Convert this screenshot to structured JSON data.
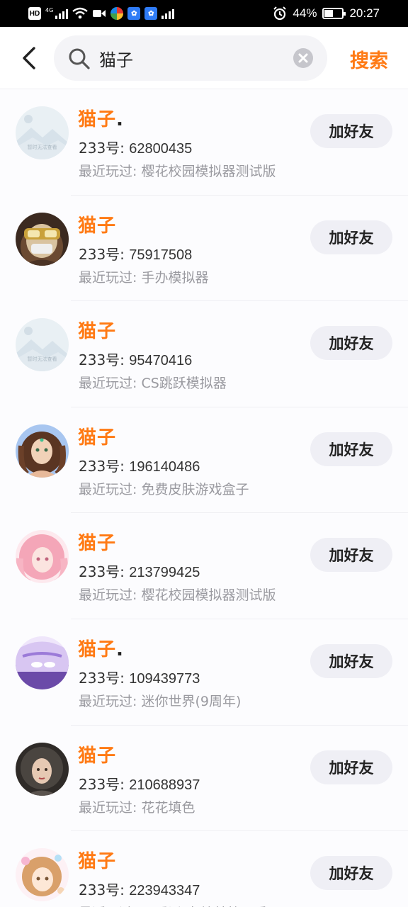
{
  "status_bar": {
    "left_icons": [
      "HD",
      "4G"
    ],
    "battery": "44%",
    "battery_level": 0.44,
    "time": "20:27"
  },
  "header": {
    "search": {
      "value": "猫子",
      "placeholder": ""
    },
    "search_button": "搜索"
  },
  "labels": {
    "add_friend": "加好友",
    "id_prefix": "233号: ",
    "recent_prefix": "最近玩过: "
  },
  "results": [
    {
      "name": "猫子",
      "suffix": ".",
      "id": "62800435",
      "recent": "樱花校园模拟器测试版",
      "avatar": "placeholder",
      "avatar_caption": "暂时无法查看"
    },
    {
      "name": "猫子",
      "suffix": "",
      "id": "75917508",
      "recent": "手办模拟器",
      "avatar": "masked-kid",
      "avatar_caption": ""
    },
    {
      "name": "猫子",
      "suffix": "",
      "id": "95470416",
      "recent": "CS跳跃模拟器",
      "avatar": "placeholder",
      "avatar_caption": "暂时无法查看"
    },
    {
      "name": "猫子",
      "suffix": "",
      "id": "196140486",
      "recent": "免费皮肤游戏盒子",
      "avatar": "curly-girl",
      "avatar_caption": ""
    },
    {
      "name": "猫子",
      "suffix": "",
      "id": "213799425",
      "recent": "樱花校园模拟器测试版",
      "avatar": "pink-girl",
      "avatar_caption": ""
    },
    {
      "name": "猫子",
      "suffix": ".",
      "id": "109439773",
      "recent": "迷你世界(9周年)",
      "avatar": "purple-anime",
      "avatar_caption": ""
    },
    {
      "name": "猫子",
      "suffix": "",
      "id": "210688937",
      "recent": "花花填色",
      "avatar": "dark-girl",
      "avatar_caption": ""
    },
    {
      "name": "猫子",
      "suffix": "",
      "id": "223943347",
      "recent": "可爱派对(绘梦校园季)",
      "avatar": "flower-girl",
      "avatar_caption": ""
    }
  ],
  "colors": {
    "accent": "#ff7a14",
    "status_bar": "#000000",
    "button_bg": "#efeff5",
    "secondary_text": "#9a9aa0"
  }
}
